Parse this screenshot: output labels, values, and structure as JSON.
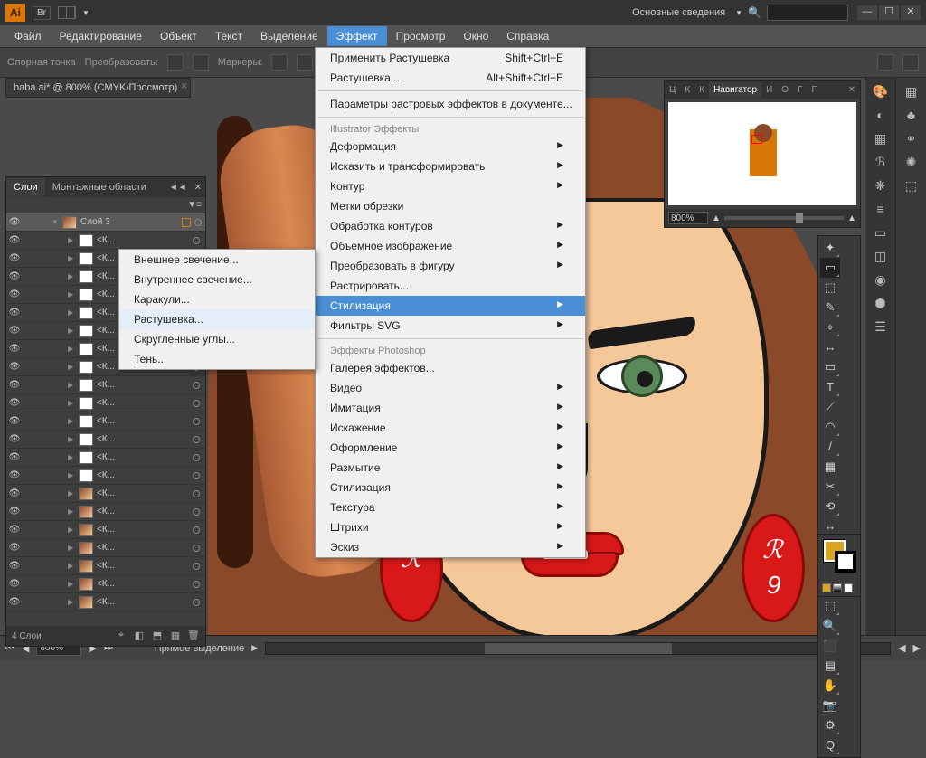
{
  "title": {
    "workspace_label": "Основные сведения",
    "logo": "Ai",
    "br": "Br"
  },
  "menu": [
    "Файл",
    "Редактирование",
    "Объект",
    "Текст",
    "Выделение",
    "Эффект",
    "Просмотр",
    "Окно",
    "Справка"
  ],
  "menu_active_index": 5,
  "control": {
    "anchor": "Опорная точка",
    "transform": "Преобразовать:",
    "handles": "Маркеры:"
  },
  "doc_tab": "baba.ai* @ 800% (CMYK/Просмотр)",
  "effect_menu": {
    "apply": "Применить Растушевка",
    "apply_sc": "Shift+Ctrl+E",
    "feather": "Растушевка...",
    "feather_sc": "Alt+Shift+Ctrl+E",
    "raster_settings": "Параметры растровых эффектов в документе...",
    "section_ai": "Illustrator  Эффекты",
    "items_ai": [
      "Деформация",
      "Исказить и трансформировать",
      "Контур",
      "Метки обрезки",
      "Обработка контуров",
      "Объемное изображение",
      "Преобразовать в фигуру",
      "Растрировать...",
      "Стилизация",
      "Фильтры SVG"
    ],
    "ai_highlight_index": 8,
    "section_ps": "Эффекты Photoshop",
    "items_ps": [
      "Галерея эффектов...",
      "Видео",
      "Имитация",
      "Искажение",
      "Оформление",
      "Размытие",
      "Стилизация",
      "Текстура",
      "Штрихи",
      "Эскиз"
    ]
  },
  "stylize_submenu": [
    "Внешнее свечение...",
    "Внутреннее свечение...",
    "Каракули...",
    "Растушевка...",
    "Скругленные углы...",
    "Тень..."
  ],
  "stylize_hover_index": 3,
  "layers": {
    "tab1": "Слои",
    "tab2": "Монтажные области",
    "parent": "Слой 3",
    "items": [
      "<К...",
      "<К...",
      "<К...",
      "<К...",
      "<К...",
      "<К...",
      "<К...",
      "<К...",
      "<К...",
      "<К...",
      "<К...",
      "<К...",
      "<К...",
      "<К...",
      "<К...",
      "<К...",
      "<К...",
      "<К...",
      "<К...",
      "<К...",
      "<К..."
    ],
    "footer": "4 Слои"
  },
  "navigator": {
    "tabs": [
      "Ц",
      "К",
      "К",
      "Навигатор",
      "И",
      "О",
      "Г",
      "П"
    ],
    "active": 3,
    "zoom": "800%"
  },
  "status": {
    "zoom": "800%",
    "tool": "Прямое выделение"
  },
  "colors": {
    "fill": "#d9a420",
    "stroke": "#000000"
  }
}
